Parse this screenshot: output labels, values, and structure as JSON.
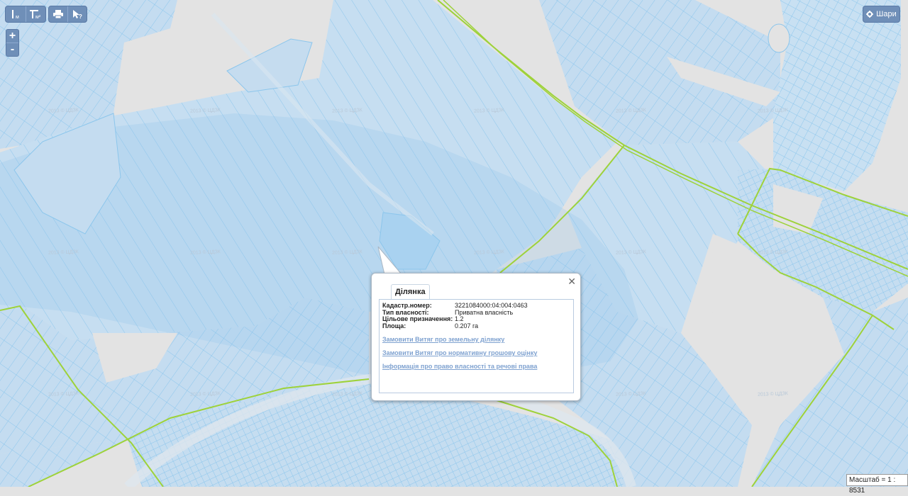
{
  "toolbar": {
    "measure_length_label": "м",
    "measure_area_label": "м²",
    "print_icon": "printer-icon",
    "identify_icon": "pointer-question-icon"
  },
  "zoom": {
    "in_label": "+",
    "out_label": "-"
  },
  "layers_button": {
    "label": "Шари",
    "icon": "gear-icon"
  },
  "popup": {
    "tab_title": "Ділянка",
    "close_label": "✕",
    "fields": [
      {
        "key": "Кадастр.номер:",
        "value": "3221084000:04:004:0463"
      },
      {
        "key": "Тип власності:",
        "value": "Приватна власність"
      },
      {
        "key": "Цільове призначення:",
        "value": "1.2"
      },
      {
        "key": "Площа:",
        "value": "0.207 га"
      }
    ],
    "links": [
      "Замовити Витяг про земельну ділянку",
      "Замовити Витяг про нормативну грошову оцінку",
      "Інформація про право власності та речові права"
    ]
  },
  "watermark": "2013 © ЦДЗК",
  "scale": {
    "label": "Масштаб = 1 : 8531"
  },
  "colors": {
    "background": "#e3e3e3",
    "parcel_fill": "#c7dff0",
    "parcel_stroke": "#8cc6ec",
    "road": "#9ed23a",
    "ui_button": "#6f8fb8"
  }
}
